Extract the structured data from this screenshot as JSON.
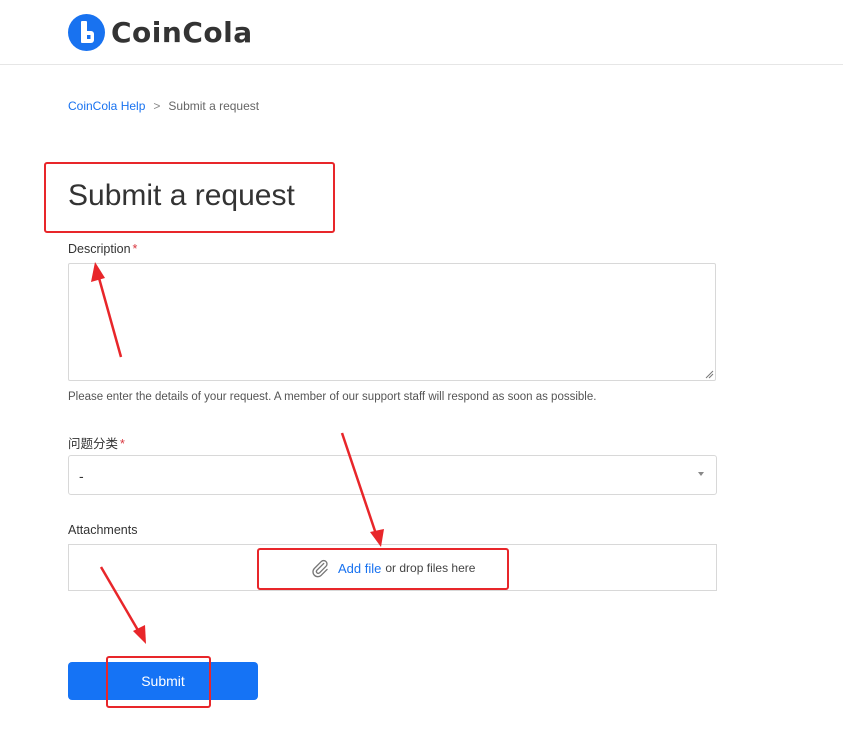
{
  "brand": {
    "name": "CoinCola",
    "color": "#1872f0"
  },
  "breadcrumb": {
    "home": "CoinCola Help",
    "separator": ">",
    "current": "Submit a request"
  },
  "page": {
    "title": "Submit a request"
  },
  "form": {
    "description": {
      "label": "Description",
      "required_mark": "*",
      "value": "",
      "hint": "Please enter the details of your request. A member of our support staff will respond as soon as possible."
    },
    "category": {
      "label": "问题分类",
      "required_mark": "*",
      "selected": "-"
    },
    "attachments": {
      "label": "Attachments",
      "add_file": "Add file",
      "drop_text": "or drop files here"
    },
    "submit_label": "Submit"
  },
  "colors": {
    "accent": "#1573f5",
    "annotation": "#e8262a",
    "required": "#d9363e"
  }
}
